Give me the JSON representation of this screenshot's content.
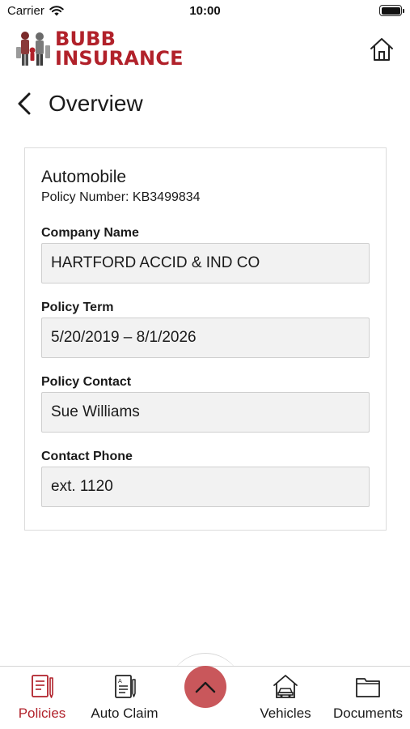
{
  "status_bar": {
    "carrier": "Carrier",
    "time": "10:00"
  },
  "header": {
    "brand_line1": "BUBB",
    "brand_line2": "INSURANCE",
    "brand_color": "#b1212a",
    "home_icon": "home-icon"
  },
  "page": {
    "title": "Overview",
    "back_icon": "chevron-left-icon"
  },
  "policy": {
    "type": "Automobile",
    "number_label": "Policy Number: KB3499834",
    "fields": [
      {
        "label": "Company Name",
        "value": "HARTFORD ACCID & IND CO"
      },
      {
        "label": "Policy Term",
        "value": "5/20/2019 – 8/1/2026"
      },
      {
        "label": "Policy Contact",
        "value": "Sue Williams"
      },
      {
        "label": "Contact Phone",
        "value": "ext. 1120"
      }
    ]
  },
  "tab_bar": {
    "tabs": [
      {
        "label": "Policies",
        "icon": "policy-document-icon",
        "active": true
      },
      {
        "label": "Auto Claim",
        "icon": "claim-form-icon",
        "active": false
      },
      {
        "label": "Vehicles",
        "icon": "vehicle-garage-icon",
        "active": false
      },
      {
        "label": "Documents",
        "icon": "folder-icon",
        "active": false
      }
    ],
    "center_button_icon": "chevron-up-icon",
    "center_button_color": "#c9575b",
    "active_color": "#b1212a"
  }
}
